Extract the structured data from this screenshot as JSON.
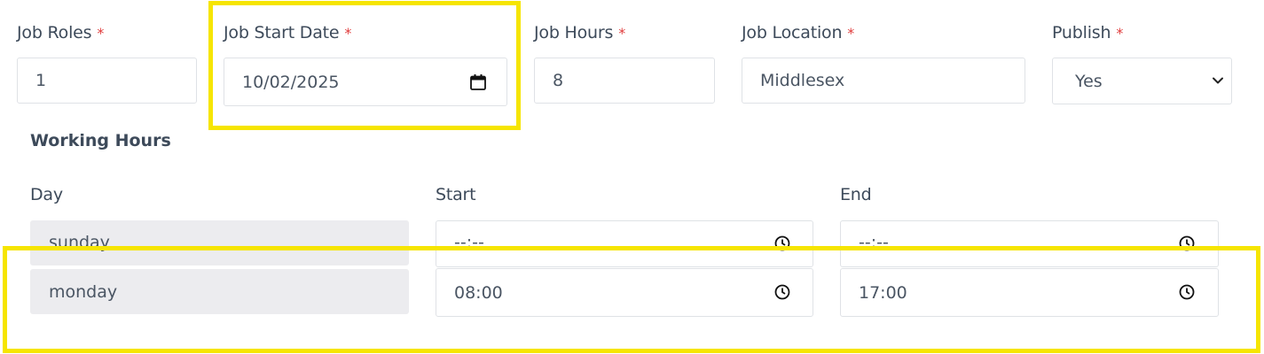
{
  "job_fields": {
    "roles_label": "Job Roles",
    "roles_value": "1",
    "start_date_label": "Job Start Date",
    "start_date_value": "10/02/2025",
    "hours_label": "Job Hours",
    "hours_value": "8",
    "location_label": "Job Location",
    "location_value": "Middlesex",
    "publish_label": "Publish",
    "publish_value": "Yes",
    "required_mark": "*"
  },
  "working_hours": {
    "title": "Working Hours",
    "day_header": "Day",
    "start_header": "Start",
    "end_header": "End",
    "rows": [
      {
        "day": "sunday",
        "start": "--:--",
        "end": "--:--"
      },
      {
        "day": "monday",
        "start": "08:00",
        "end": "17:00"
      }
    ]
  },
  "colors": {
    "highlight": "#f6e500",
    "required": "#e03b3b",
    "text": "#3d4a5a"
  },
  "icons": {
    "date_picker": "calendar-icon",
    "select_arrow": "chevron-down-icon",
    "time_picker": "clock-icon"
  }
}
